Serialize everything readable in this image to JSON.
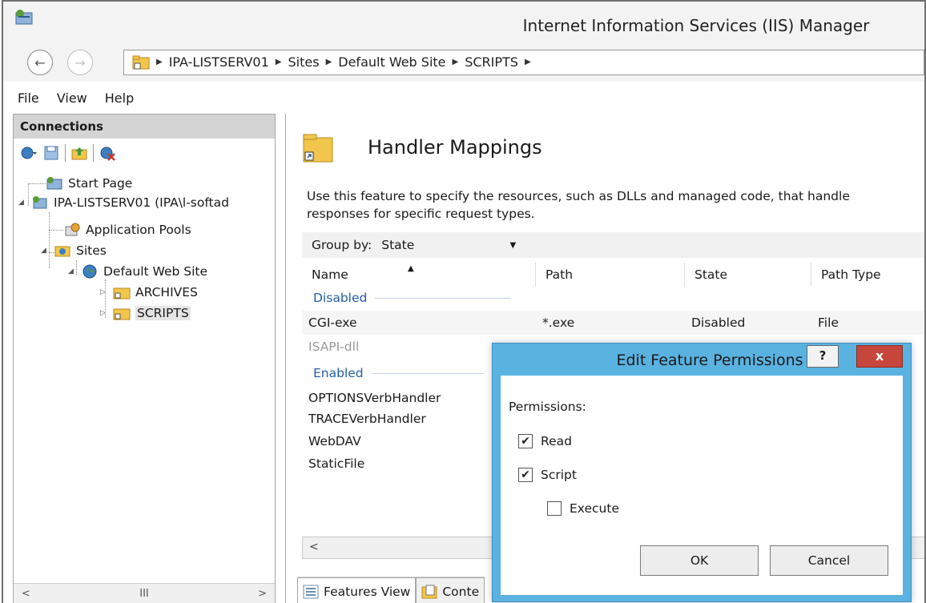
{
  "window": {
    "title": "Internet Information Services (IIS) Manager"
  },
  "address_bar": {
    "crumbs": [
      "IPA-LISTSERV01",
      "Sites",
      "Default Web Site",
      "SCRIPTS"
    ]
  },
  "menu": {
    "file": "File",
    "view": "View",
    "help": "Help"
  },
  "connections": {
    "header": "Connections",
    "tree": [
      {
        "label": "Start Page",
        "icon": "start-page-icon"
      },
      {
        "label": "IPA-LISTSERV01 (IPA\\l-softad",
        "icon": "server-icon"
      },
      {
        "label": "Application Pools",
        "icon": "app-pools-icon"
      },
      {
        "label": "Sites",
        "icon": "sites-folder-icon"
      },
      {
        "label": "Default Web Site",
        "icon": "globe-icon"
      },
      {
        "label": "ARCHIVES",
        "icon": "folder-icon"
      },
      {
        "label": "SCRIPTS",
        "icon": "folder-icon"
      }
    ],
    "scroll_thumb": "III"
  },
  "feature": {
    "title": "Handler Mappings",
    "description": "Use this feature to specify the resources, such as DLLs and managed code, that handle responses for specific request types.",
    "group_by_label": "Group by:",
    "group_by_value": "State",
    "columns": [
      "Name",
      "Path",
      "State",
      "Path Type"
    ],
    "groups": [
      {
        "label": "Disabled",
        "rows": [
          {
            "name": "CGI-exe",
            "path": "*.exe",
            "state": "Disabled",
            "path_type": "File"
          },
          {
            "name": "ISAPI-dll",
            "path": "",
            "state": "",
            "path_type": ""
          }
        ]
      },
      {
        "label": "Enabled",
        "rows": [
          {
            "name": "OPTIONSVerbHandler"
          },
          {
            "name": "TRACEVerbHandler"
          },
          {
            "name": "WebDAV"
          },
          {
            "name": "StaticFile"
          }
        ]
      }
    ],
    "tabs": {
      "features_view": "Features View",
      "content_view": "Conte"
    }
  },
  "dialog": {
    "title": "Edit Feature Permissions",
    "help": "?",
    "close": "x",
    "permissions_label": "Permissions:",
    "options": [
      {
        "label": "Read",
        "checked": true
      },
      {
        "label": "Script",
        "checked": true
      },
      {
        "label": "Execute",
        "checked": false
      }
    ],
    "ok": "OK",
    "cancel": "Cancel"
  },
  "colors": {
    "dialog_frame": "#5ab2e0",
    "close_button": "#c7463b",
    "group_header": "#245ea8"
  }
}
